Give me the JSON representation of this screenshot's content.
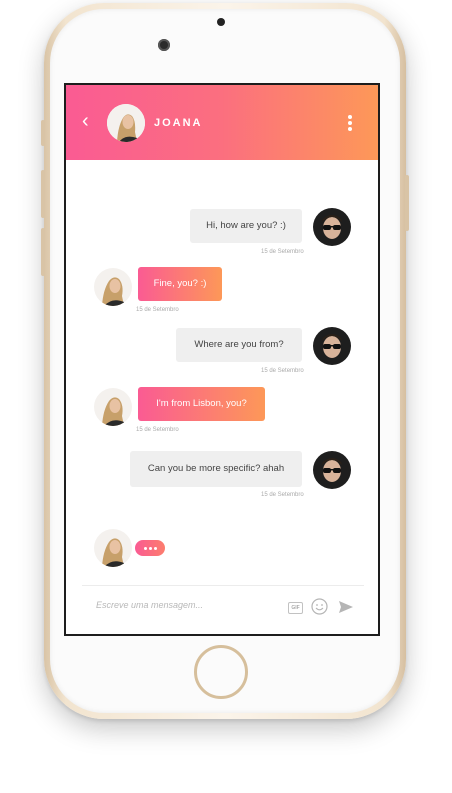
{
  "header": {
    "back_icon": "‹",
    "contact_name": "JOANA"
  },
  "messages": [
    {
      "id": "m1",
      "direction": "out",
      "text": "Hi, how are you? :)",
      "time": "15 de Setembro"
    },
    {
      "id": "m2",
      "direction": "in",
      "text": "Fine, you? :)",
      "time": "15 de Setembro"
    },
    {
      "id": "m3",
      "direction": "out",
      "text": "Where are you from?",
      "time": "15 de Setembro"
    },
    {
      "id": "m4",
      "direction": "in",
      "text": "I'm from Lisbon, you?",
      "time": "15 de Setembro"
    },
    {
      "id": "m5",
      "direction": "out",
      "text": "Can you be more specific? ahah",
      "time": "15 de Setembro"
    }
  ],
  "typing_indicator": "typing-dots-icon",
  "composer": {
    "placeholder": "Escreve uma mensagem...",
    "gif_label": "GIF",
    "emoji_icon": "smiley-icon",
    "send_icon": "send-icon"
  },
  "colors": {
    "accent_start": "#fa5b93",
    "accent_end": "#fd9858",
    "outgoing_bubble": "#efefef"
  }
}
